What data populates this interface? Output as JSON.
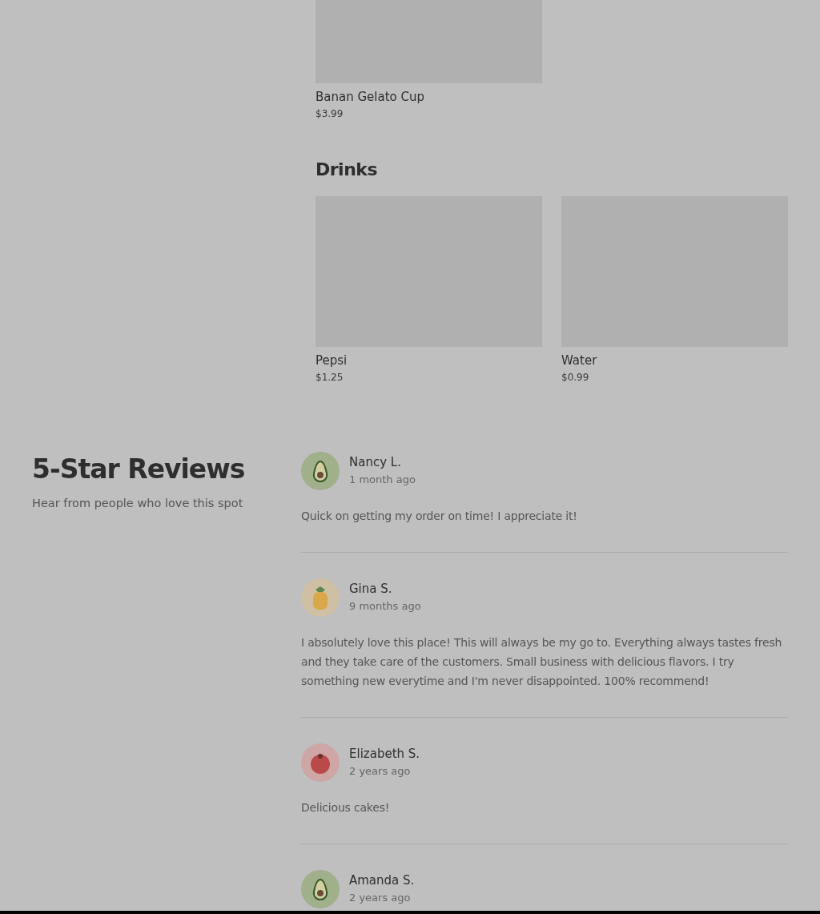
{
  "menu": {
    "sections": [
      {
        "items": [
          {
            "name": "Banan Gelato Cup",
            "price": "$3.99"
          }
        ]
      },
      {
        "title": "Drinks",
        "items": [
          {
            "name": "Pepsi",
            "price": "$1.25"
          },
          {
            "name": "Water",
            "price": "$0.99"
          }
        ]
      }
    ]
  },
  "reviews": {
    "title": "5-Star Reviews",
    "subtitle": "Hear from people who love this spot",
    "items": [
      {
        "avatar": {
          "kind": "avocado"
        },
        "name": "Nancy L.",
        "date": "1 month ago",
        "text": "Quick on getting my order on time! I appreciate it!"
      },
      {
        "avatar": {
          "kind": "pineapple"
        },
        "name": "Gina S.",
        "date": "9 months ago",
        "text": "I absolutely love this place! This will always be my go to. Everything always tastes fresh and they take care of the customers. Small business with delicious flavors. I try something new everytime and I'm never disappointed. 100% recommend!"
      },
      {
        "avatar": {
          "kind": "tomato"
        },
        "name": "Elizabeth S.",
        "date": "2 years ago",
        "text": "Delicious cakes!"
      },
      {
        "avatar": {
          "kind": "avocado"
        },
        "name": "Amanda S.",
        "date": "2 years ago"
      }
    ]
  }
}
